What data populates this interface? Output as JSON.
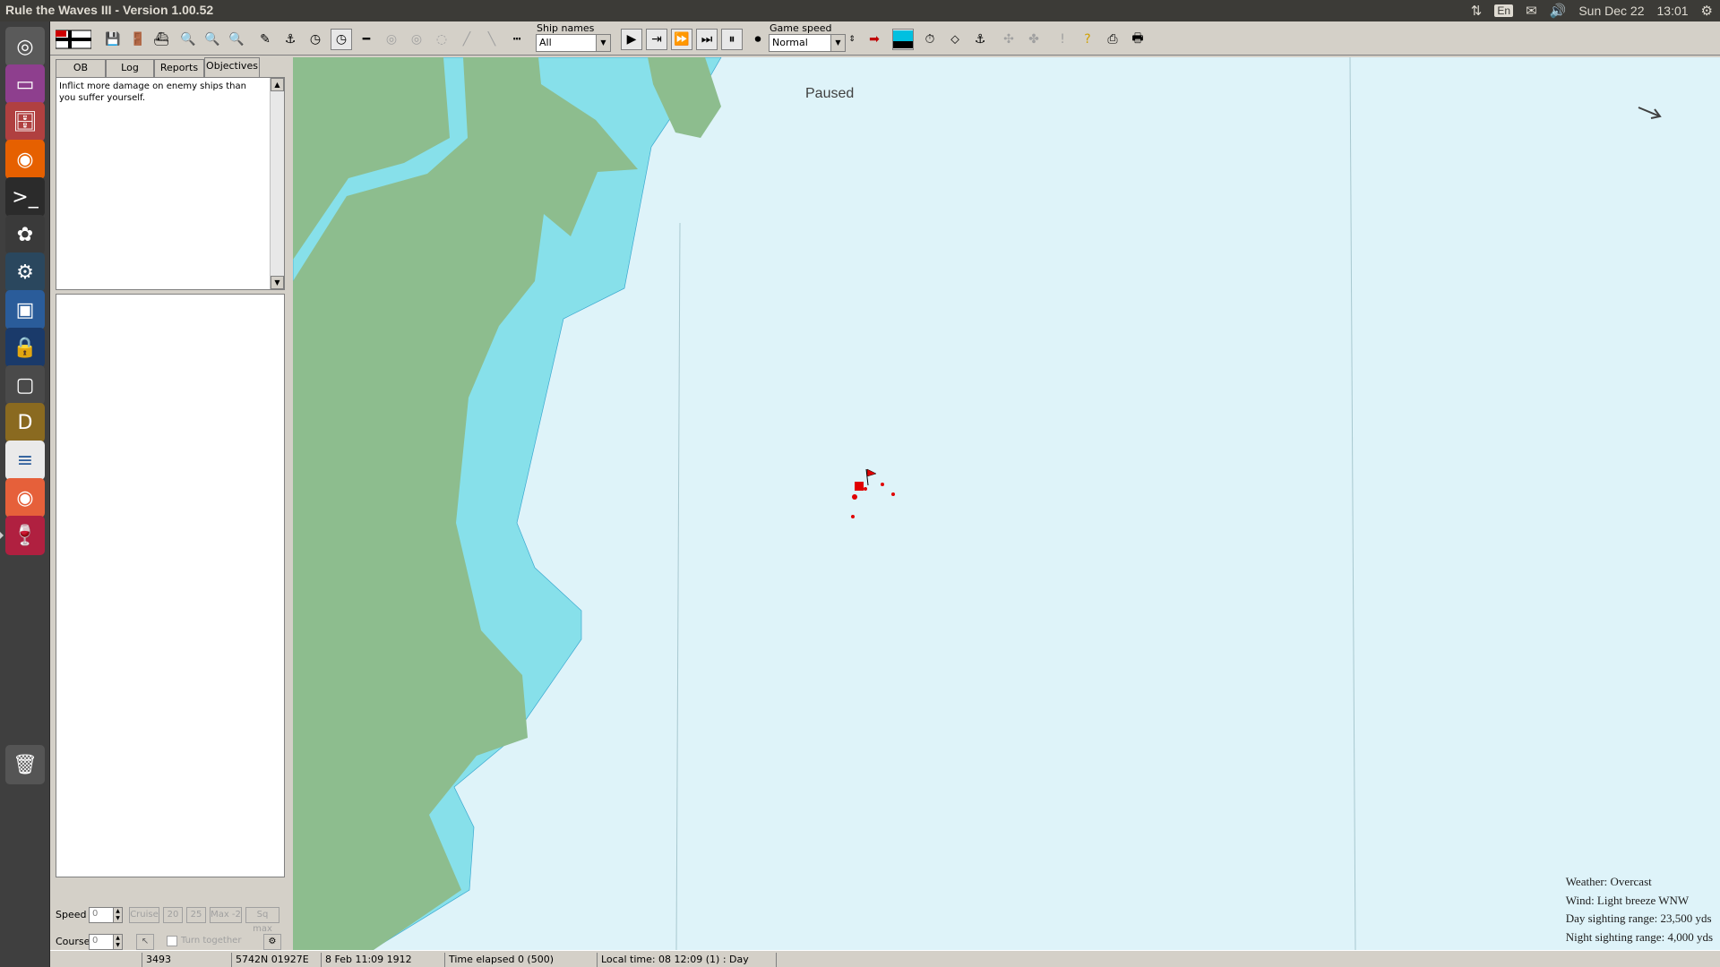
{
  "topbar": {
    "title": "Rule the Waves III - Version 1.00.52",
    "lang": "En",
    "date": "Sun Dec 22",
    "time": "13:01"
  },
  "launcher": {
    "items": [
      {
        "name": "ubuntu-dash-icon",
        "glyph": "◎",
        "bg": "#5a5a5a"
      },
      {
        "name": "workspace-icon",
        "glyph": "▭",
        "bg": "#8e3f8e"
      },
      {
        "name": "files-icon",
        "glyph": "🗄",
        "bg": "#b04040"
      },
      {
        "name": "firefox-icon",
        "glyph": "◉",
        "bg": "#e66000"
      },
      {
        "name": "terminal-icon",
        "glyph": ">_",
        "bg": "#2b2b2b"
      },
      {
        "name": "color-picker-icon",
        "glyph": "✿",
        "bg": "#3a3a3a"
      },
      {
        "name": "steam-icon",
        "glyph": "⚙",
        "bg": "#2a475e"
      },
      {
        "name": "virtualbox-icon",
        "glyph": "▣",
        "bg": "#2a5c9a"
      },
      {
        "name": "lock-icon",
        "glyph": "🔒",
        "bg": "#1a3a6a"
      },
      {
        "name": "window-icon",
        "glyph": "▢",
        "bg": "#4a4a4a"
      },
      {
        "name": "dosbox-icon",
        "glyph": "D",
        "bg": "#8a6a20"
      },
      {
        "name": "text-editor-icon",
        "glyph": "≡",
        "bg": "#eaeaea"
      },
      {
        "name": "firefox-dev-icon",
        "glyph": "◉",
        "bg": "#e6603a"
      },
      {
        "name": "wine-icon",
        "glyph": "🍷",
        "bg": "#b02040"
      },
      {
        "name": "trash-icon",
        "glyph": "🗑",
        "bg": "#555555"
      }
    ]
  },
  "toolbar": {
    "ship_names_label": "Ship names",
    "ship_names_value": "All",
    "game_speed_label": "Game speed",
    "game_speed_value": "Normal"
  },
  "left_panel": {
    "tabs": [
      {
        "label": "OB"
      },
      {
        "label": "Log"
      },
      {
        "label": "Reports"
      },
      {
        "label": "Objectives"
      }
    ],
    "active_tab": "Objectives",
    "objective_text": "Inflict more damage on enemy ships than you suffer yourself.",
    "speed_label": "Speed",
    "speed_value": "0",
    "course_label": "Course",
    "course_value": "0",
    "speed_buttons": [
      "Cruise",
      "20",
      "25",
      "Max -2",
      "Sq max"
    ],
    "turn_together_label": "Turn together"
  },
  "map": {
    "paused_label": "Paused",
    "land_color": "#8dbd8e",
    "shallow_color": "#87e0ea",
    "sea_color": "#def3f9",
    "unit_color": "#e00000"
  },
  "weather": {
    "weather": "Weather: Overcast",
    "wind": "Wind: Light breeze  WNW",
    "day_range": "Day sighting range: 23,500 yds",
    "night_range": "Night sighting range: 4,000 yds"
  },
  "statusbar": {
    "cell1": "",
    "cell2": "3493",
    "cell3": "5742N 01927E",
    "cell4": "8 Feb 11:09 1912",
    "cell5": "Time elapsed 0 (500)",
    "cell6": "Local time: 08 12:09 (1) : Day"
  }
}
